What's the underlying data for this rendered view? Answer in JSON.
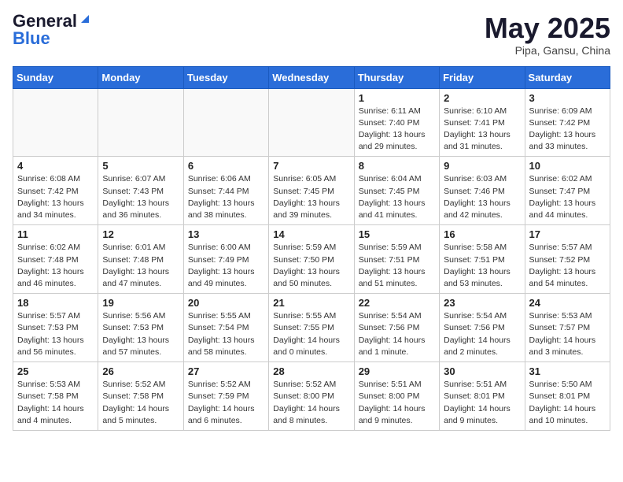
{
  "header": {
    "logo_general": "General",
    "logo_blue": "Blue",
    "month_title": "May 2025",
    "location": "Pipa, Gansu, China"
  },
  "weekdays": [
    "Sunday",
    "Monday",
    "Tuesday",
    "Wednesday",
    "Thursday",
    "Friday",
    "Saturday"
  ],
  "weeks": [
    [
      {
        "day": "",
        "info": ""
      },
      {
        "day": "",
        "info": ""
      },
      {
        "day": "",
        "info": ""
      },
      {
        "day": "",
        "info": ""
      },
      {
        "day": "1",
        "info": "Sunrise: 6:11 AM\nSunset: 7:40 PM\nDaylight: 13 hours\nand 29 minutes."
      },
      {
        "day": "2",
        "info": "Sunrise: 6:10 AM\nSunset: 7:41 PM\nDaylight: 13 hours\nand 31 minutes."
      },
      {
        "day": "3",
        "info": "Sunrise: 6:09 AM\nSunset: 7:42 PM\nDaylight: 13 hours\nand 33 minutes."
      }
    ],
    [
      {
        "day": "4",
        "info": "Sunrise: 6:08 AM\nSunset: 7:42 PM\nDaylight: 13 hours\nand 34 minutes."
      },
      {
        "day": "5",
        "info": "Sunrise: 6:07 AM\nSunset: 7:43 PM\nDaylight: 13 hours\nand 36 minutes."
      },
      {
        "day": "6",
        "info": "Sunrise: 6:06 AM\nSunset: 7:44 PM\nDaylight: 13 hours\nand 38 minutes."
      },
      {
        "day": "7",
        "info": "Sunrise: 6:05 AM\nSunset: 7:45 PM\nDaylight: 13 hours\nand 39 minutes."
      },
      {
        "day": "8",
        "info": "Sunrise: 6:04 AM\nSunset: 7:45 PM\nDaylight: 13 hours\nand 41 minutes."
      },
      {
        "day": "9",
        "info": "Sunrise: 6:03 AM\nSunset: 7:46 PM\nDaylight: 13 hours\nand 42 minutes."
      },
      {
        "day": "10",
        "info": "Sunrise: 6:02 AM\nSunset: 7:47 PM\nDaylight: 13 hours\nand 44 minutes."
      }
    ],
    [
      {
        "day": "11",
        "info": "Sunrise: 6:02 AM\nSunset: 7:48 PM\nDaylight: 13 hours\nand 46 minutes."
      },
      {
        "day": "12",
        "info": "Sunrise: 6:01 AM\nSunset: 7:48 PM\nDaylight: 13 hours\nand 47 minutes."
      },
      {
        "day": "13",
        "info": "Sunrise: 6:00 AM\nSunset: 7:49 PM\nDaylight: 13 hours\nand 49 minutes."
      },
      {
        "day": "14",
        "info": "Sunrise: 5:59 AM\nSunset: 7:50 PM\nDaylight: 13 hours\nand 50 minutes."
      },
      {
        "day": "15",
        "info": "Sunrise: 5:59 AM\nSunset: 7:51 PM\nDaylight: 13 hours\nand 51 minutes."
      },
      {
        "day": "16",
        "info": "Sunrise: 5:58 AM\nSunset: 7:51 PM\nDaylight: 13 hours\nand 53 minutes."
      },
      {
        "day": "17",
        "info": "Sunrise: 5:57 AM\nSunset: 7:52 PM\nDaylight: 13 hours\nand 54 minutes."
      }
    ],
    [
      {
        "day": "18",
        "info": "Sunrise: 5:57 AM\nSunset: 7:53 PM\nDaylight: 13 hours\nand 56 minutes."
      },
      {
        "day": "19",
        "info": "Sunrise: 5:56 AM\nSunset: 7:53 PM\nDaylight: 13 hours\nand 57 minutes."
      },
      {
        "day": "20",
        "info": "Sunrise: 5:55 AM\nSunset: 7:54 PM\nDaylight: 13 hours\nand 58 minutes."
      },
      {
        "day": "21",
        "info": "Sunrise: 5:55 AM\nSunset: 7:55 PM\nDaylight: 14 hours\nand 0 minutes."
      },
      {
        "day": "22",
        "info": "Sunrise: 5:54 AM\nSunset: 7:56 PM\nDaylight: 14 hours\nand 1 minute."
      },
      {
        "day": "23",
        "info": "Sunrise: 5:54 AM\nSunset: 7:56 PM\nDaylight: 14 hours\nand 2 minutes."
      },
      {
        "day": "24",
        "info": "Sunrise: 5:53 AM\nSunset: 7:57 PM\nDaylight: 14 hours\nand 3 minutes."
      }
    ],
    [
      {
        "day": "25",
        "info": "Sunrise: 5:53 AM\nSunset: 7:58 PM\nDaylight: 14 hours\nand 4 minutes."
      },
      {
        "day": "26",
        "info": "Sunrise: 5:52 AM\nSunset: 7:58 PM\nDaylight: 14 hours\nand 5 minutes."
      },
      {
        "day": "27",
        "info": "Sunrise: 5:52 AM\nSunset: 7:59 PM\nDaylight: 14 hours\nand 6 minutes."
      },
      {
        "day": "28",
        "info": "Sunrise: 5:52 AM\nSunset: 8:00 PM\nDaylight: 14 hours\nand 8 minutes."
      },
      {
        "day": "29",
        "info": "Sunrise: 5:51 AM\nSunset: 8:00 PM\nDaylight: 14 hours\nand 9 minutes."
      },
      {
        "day": "30",
        "info": "Sunrise: 5:51 AM\nSunset: 8:01 PM\nDaylight: 14 hours\nand 9 minutes."
      },
      {
        "day": "31",
        "info": "Sunrise: 5:50 AM\nSunset: 8:01 PM\nDaylight: 14 hours\nand 10 minutes."
      }
    ]
  ]
}
